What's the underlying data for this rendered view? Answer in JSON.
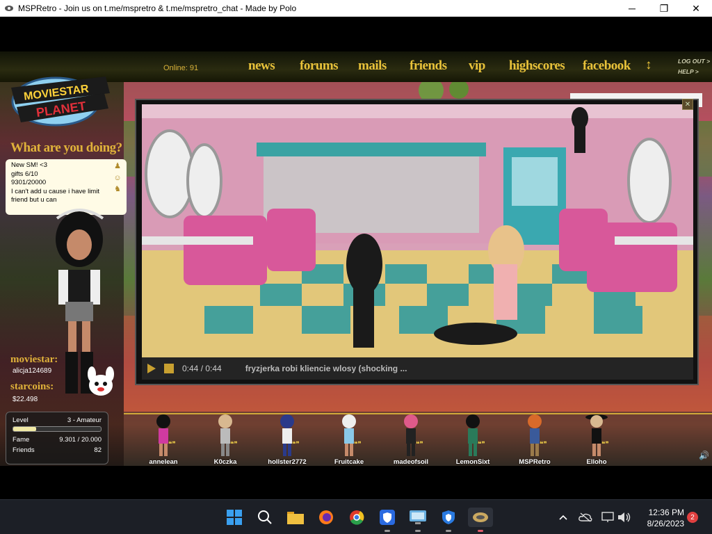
{
  "window": {
    "title": "MSPRetro - Join us on t.me/mspretro & t.me/mspretro_chat - Made by Polo",
    "minimize": "─",
    "maximize": "❐",
    "close": "✕"
  },
  "nav": {
    "online": "Online: 91",
    "items": [
      "news",
      "forums",
      "mails",
      "friends",
      "vip",
      "highscores",
      "facebook"
    ],
    "arrow": "↕",
    "logout": "LOG OUT >",
    "help": "HELP >"
  },
  "logo": {
    "line1": "MOVIESTAR",
    "line2": "PLANET"
  },
  "profile": {
    "prompt": "What are you doing?",
    "status_lines": [
      "New SM! <3",
      "gifts 6/10",
      "9301/20000",
      "I can't add u cause i have limit",
      "friend but u can"
    ],
    "moviestar_label": "moviestar:",
    "username": "alicja124689",
    "starcoins_label": "starcoins:",
    "starcoins": "$22.498"
  },
  "stats": {
    "level_label": "Level",
    "level_value": "3 - Amateur",
    "level_progress": 0.26,
    "fame_label": "Fame",
    "fame_value": "9.301 / 20.000",
    "friends_label": "Friends",
    "friends_value": "82"
  },
  "video": {
    "time": "0:44 / 0:44",
    "title": "fryzjerka robi kliencie wlosy (shocking ...",
    "close": "✕"
  },
  "room_users": [
    "annelean",
    "K0czka",
    "hollster2772",
    "Fruitcake",
    "madeofsoil",
    "LemonSixt",
    "MSPRetro",
    "Elloho"
  ],
  "colors": {
    "nav_gold": "#e8c23a",
    "taskbar": "#1c1f26"
  },
  "taskbar": {
    "time": "12:36 PM",
    "date": "8/26/2023",
    "notifications": "2"
  }
}
